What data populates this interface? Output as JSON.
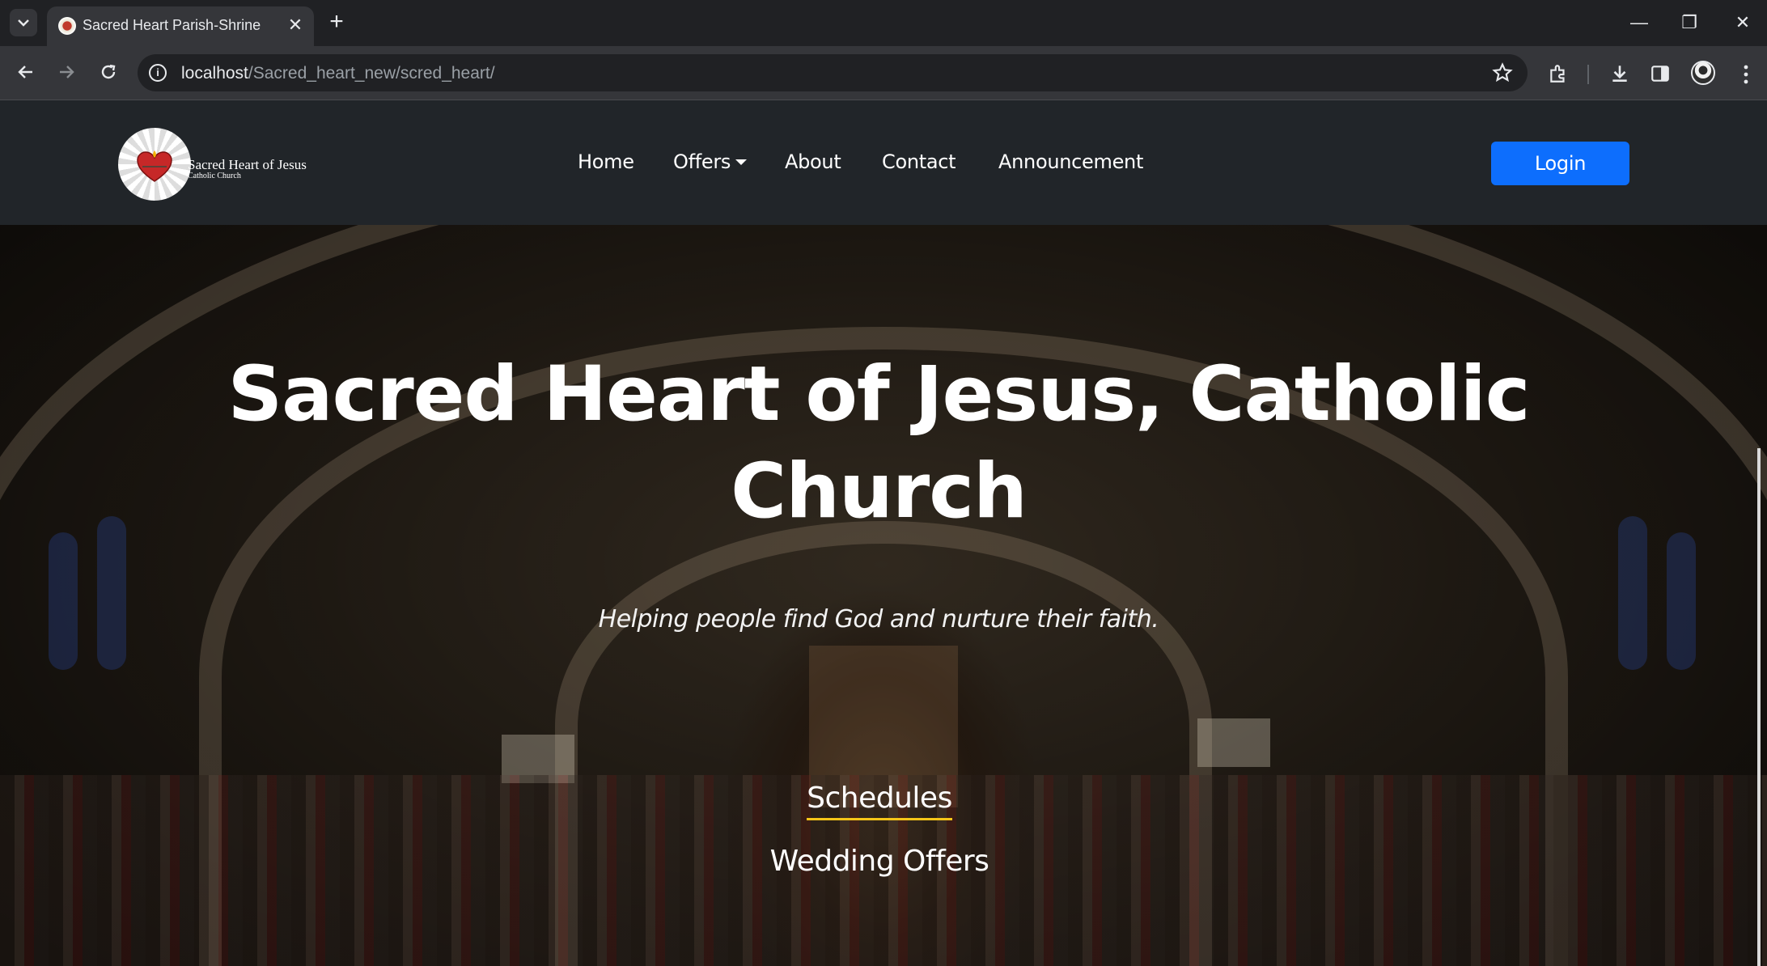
{
  "browser": {
    "tab_title": "Sacred Heart Parish-Shrine",
    "tab_close": "✕",
    "new_tab": "+",
    "url_host": "localhost",
    "url_path": "/Sacred_heart_new/scred_heart/",
    "window_controls": {
      "minimize": "—",
      "restore": "❐",
      "close": "✕"
    }
  },
  "site": {
    "logo": {
      "line1": "Sacred Heart of Jesus",
      "line2": "Catholic Church"
    },
    "nav": [
      {
        "label": "Home"
      },
      {
        "label": "Offers"
      },
      {
        "label": "About"
      },
      {
        "label": "Contact"
      },
      {
        "label": "Announcement"
      }
    ],
    "login_label": "Login",
    "hero": {
      "title": "Sacred Heart of Jesus, Catholic Church",
      "subtitle": "Helping people find God and nurture their faith.",
      "links": [
        {
          "label": "Schedules"
        },
        {
          "label": "Wedding Offers"
        }
      ]
    }
  },
  "colors": {
    "header_bg": "#212529",
    "login_button": "#0d6efd",
    "active_underline": "#f5c518"
  }
}
